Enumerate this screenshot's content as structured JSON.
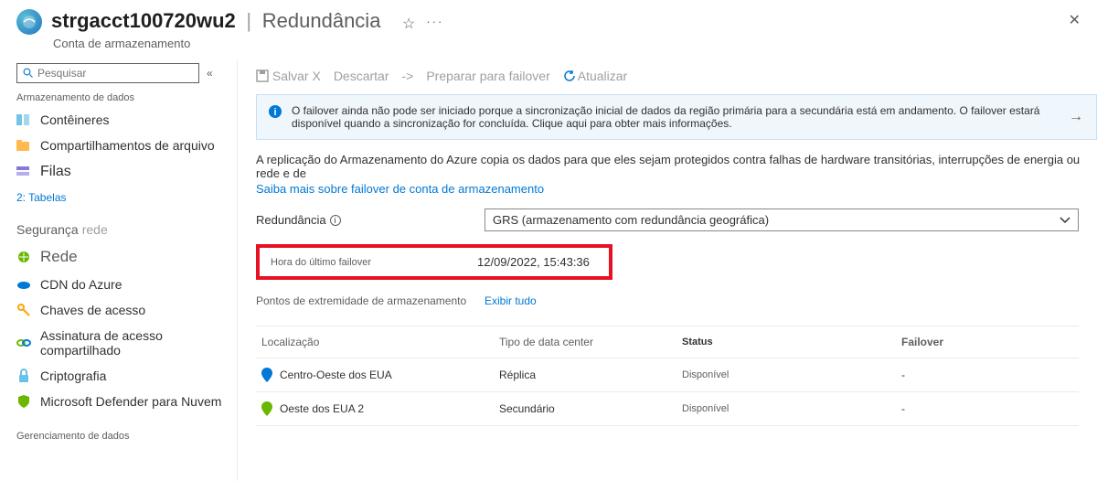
{
  "header": {
    "title": "strgacct100720wu2",
    "subtitle": "Redundância",
    "resource_type": "Conta de armazenamento"
  },
  "sidebar": {
    "search_placeholder": "Pesquisar",
    "section_data": "Armazenamento de dados",
    "items_data": [
      {
        "label": "Contêineres"
      },
      {
        "label": "Compartilhamentos de arquivo"
      },
      {
        "label": "Filas"
      }
    ],
    "tables_link": "2: Tabelas",
    "section_security": "Segurança",
    "section_security_faded": "rede",
    "items_security": [
      {
        "label": "Rede"
      },
      {
        "label": "CDN do Azure"
      },
      {
        "label": "Chaves de acesso"
      },
      {
        "label": "Assinatura de acesso compartilhado"
      },
      {
        "label": "Criptografia"
      },
      {
        "label": "Microsoft Defender para Nuvem"
      }
    ],
    "section_mgmt": "Gerenciamento de dados"
  },
  "toolbar": {
    "save": "Salvar",
    "discard": "Descartar",
    "prepare": "Preparar para failover",
    "refresh": "Atualizar"
  },
  "banner": {
    "text": "O failover ainda não pode ser iniciado porque a sincronização inicial de dados da região primária para a secundária está em andamento. O failover estará disponível quando a sincronização for concluída. Clique aqui para obter mais informações."
  },
  "description": "A replicação do Armazenamento do Azure copia os dados para que eles sejam protegidos contra falhas de hardware transitórias, interrupções de energia ou rede e de",
  "learn_more": "Saiba mais sobre failover de conta de armazenamento",
  "redundancy": {
    "label": "Redundância",
    "value": "GRS (armazenamento com redundância geográfica)"
  },
  "last_failover": {
    "label": "Hora do último failover",
    "value": "12/09/2022, 15:43:36"
  },
  "endpoints": {
    "label": "Pontos de extremidade de armazenamento",
    "show_all": "Exibir tudo"
  },
  "table": {
    "headers": {
      "loc": "Localização",
      "type": "Tipo de data center",
      "status": "Status",
      "failover": "Failover"
    },
    "rows": [
      {
        "loc": "Centro-Oeste dos EUA",
        "type": "Réplica",
        "status": "Disponível",
        "failover": "-",
        "color": "#0078d4"
      },
      {
        "loc": "Oeste dos EUA 2",
        "type": "Secundário",
        "status": "Disponível",
        "failover": "-",
        "color": "#6bb700"
      }
    ]
  }
}
